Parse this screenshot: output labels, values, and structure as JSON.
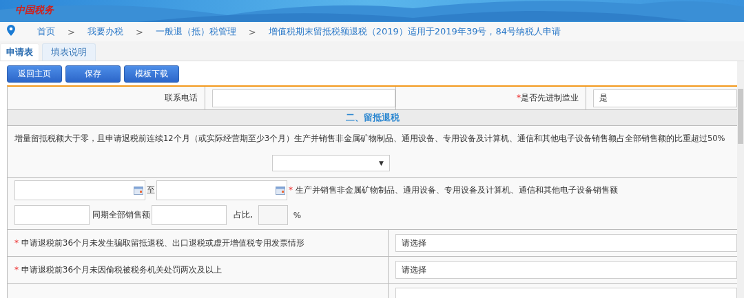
{
  "header": {
    "logo_text": "中国税务"
  },
  "breadcrumb": [
    {
      "label": "首页"
    },
    {
      "label": "我要办税",
      "sep": ">"
    },
    {
      "label": "一般退（抵）税管理",
      "sep": ">"
    },
    {
      "label": "增值税期末留抵税额退税（2019）适用于2019年39号，84号纳税人申请",
      "sep": ">"
    }
  ],
  "tabs": [
    {
      "label": "申请表",
      "selected": true
    },
    {
      "label": "填表说明",
      "selected": false
    }
  ],
  "buttons": [
    "返回主页",
    "保存",
    "模板下载"
  ],
  "form": {
    "contact": {
      "label": "联系电话"
    },
    "manufacturing": {
      "mark": "*",
      "label": "是否先进制造业",
      "value": "是"
    },
    "section_title": "二、留抵退税",
    "condition": {
      "caret": "▼",
      "text": "增量留抵税额大于零，且申请退税前连续12个月（或实际经营期至少3个月）生产并销售非金属矿物制品、通用设备、专用设备及计算机、通信和其他电子设备销售额占全部销售额的比重超过50%"
    },
    "period": {
      "to_label": "至",
      "mark": "*",
      "label": "生产并销售非金属矿物制品、通用设备、专用设备及计算机、通信和其他电子设备销售额"
    },
    "ratio": {
      "total_label": "同期全部销售额",
      "ratio_label": "占比,",
      "unit": "%"
    },
    "questions": [
      {
        "mark": "*",
        "label": "申请退税前36个月未发生骗取留抵退税、出口退税或虚开增值税专用发票情形",
        "value": "请选择"
      },
      {
        "mark": "*",
        "label": "申请退税前36个月未因偷税被税务机关处罚两次及以上",
        "value": "请选择"
      }
    ]
  }
}
